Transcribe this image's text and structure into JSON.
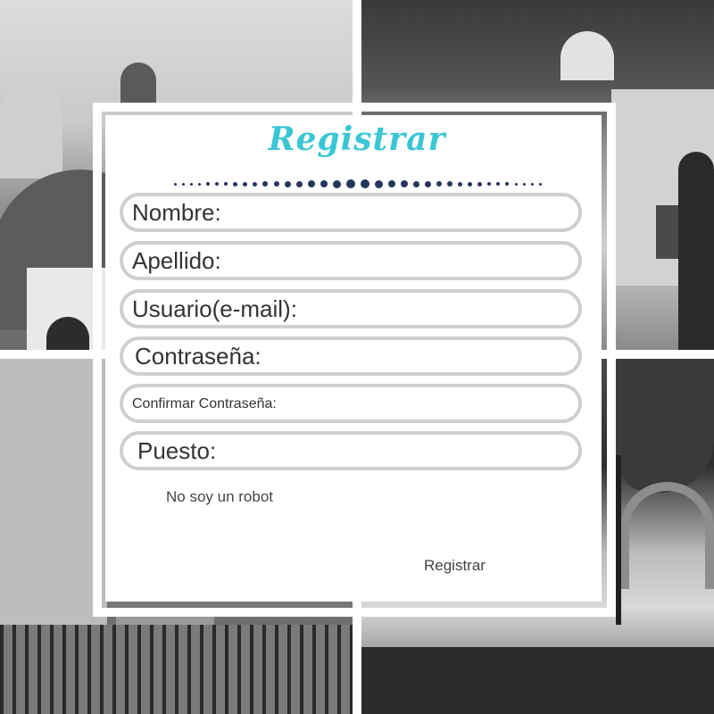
{
  "form": {
    "title": "Registrar",
    "fields": [
      {
        "label": "Nombre:"
      },
      {
        "label": "Apellido:"
      },
      {
        "label": "Usuario(e-mail):"
      },
      {
        "label": "Contraseña:"
      },
      {
        "label": "Confirmar  Contraseña:"
      },
      {
        "label": "Puesto:"
      }
    ],
    "captcha_label": "No soy un robot",
    "submit_label": "Registrar"
  },
  "colors": {
    "title": "#3bc6d4",
    "dots": "#24365c",
    "field_border": "#cfcfcf",
    "card": "#ffffff"
  },
  "background": {
    "style": "grayscale photo collage",
    "tiles": [
      "church-dome",
      "church-facade",
      "colonial-street",
      "park-arch"
    ]
  }
}
